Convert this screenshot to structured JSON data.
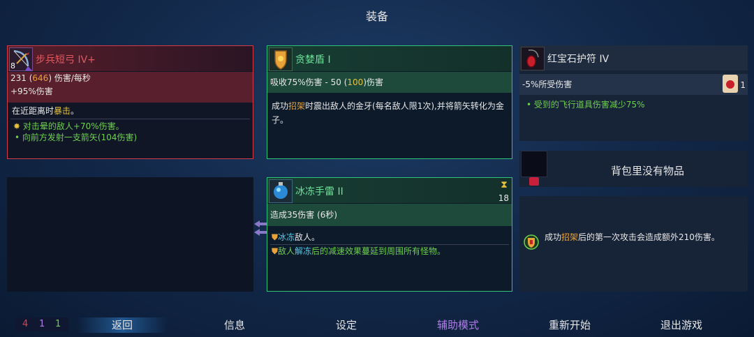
{
  "title": "装备",
  "weapon": {
    "name": "步兵短弓 IV+",
    "level": "8",
    "dps": "231",
    "dps_alt": "646",
    "dps_unit": "伤害/每秒",
    "bonus": "+95%伤害",
    "desc_pre": "在近距离时",
    "desc_hl": "暴击",
    "desc_post": "。",
    "mod1": "对击晕的敌人+70%伤害。",
    "mod2": "向前方发射一支箭矢(104伤害)"
  },
  "shield": {
    "name": "贪婪盾 I",
    "stat_pre": "吸收75%伤害 - 50 (",
    "stat_alt": "100",
    "stat_post": ")伤害",
    "desc_pre": "成功",
    "desc_hl": "招架",
    "desc_post": "时震出敌人的金牙(每名敌人限1次),并将箭矢转化为金子。"
  },
  "grenade": {
    "name": "冰冻手雷 II",
    "cooldown": "18",
    "stat": "造成35伤害 (6秒)",
    "line1_hl": "冰冻",
    "line1_post": "敌人。",
    "line2_pre": "敌人",
    "line2_hl": "解冻",
    "line2_post": "后的减速效果蔓延到周围所有怪物。"
  },
  "amulet": {
    "name": "红宝石护符 IV",
    "stat": "-5%所受伤害",
    "count": "1",
    "mod": "受到的飞行道具伤害减少75%"
  },
  "backpack": {
    "text": "背包里没有物品"
  },
  "mutation": {
    "desc_pre": "成功",
    "desc_hl": "招架",
    "desc_post": "后的第一次攻击会造成额外210伤害。"
  },
  "bottom": {
    "stats": [
      "4",
      "1",
      "1"
    ],
    "back": "返回",
    "info": "信息",
    "settings": "设定",
    "assist": "辅助模式",
    "restart": "重新开始",
    "quit": "退出游戏"
  },
  "colors": {
    "red": "#d33c46",
    "purple": "#a77be0",
    "green": "#6ecf4f",
    "gold": "#e8c13a"
  }
}
